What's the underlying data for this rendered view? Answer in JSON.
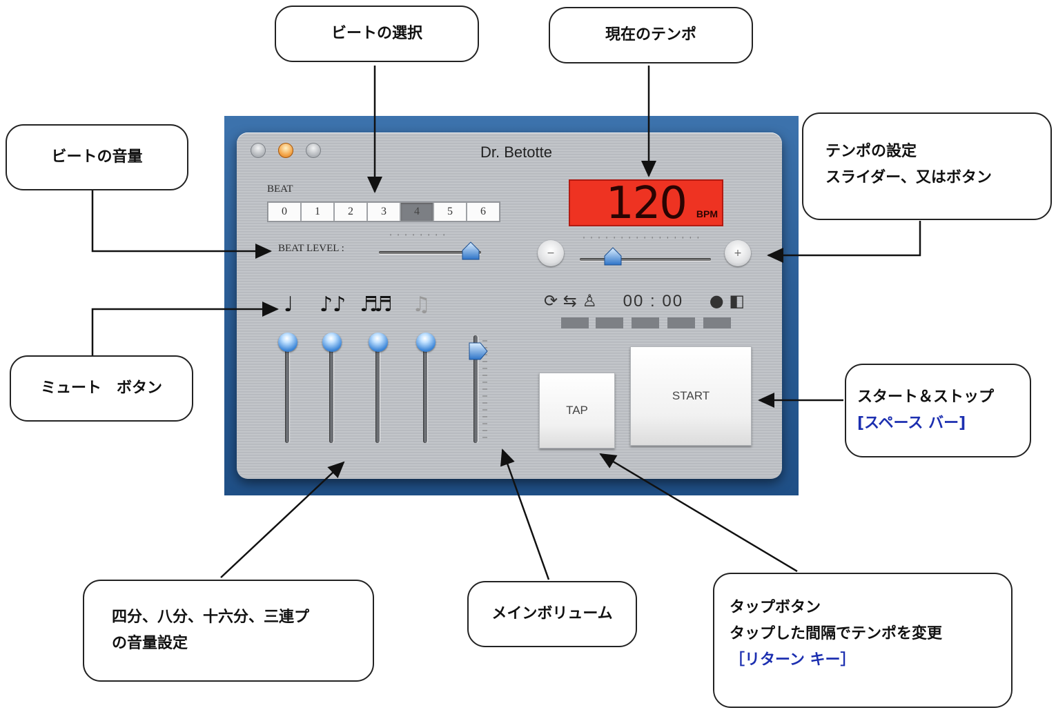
{
  "window": {
    "title": "Dr. Betotte",
    "beat_label": "BEAT",
    "beats": [
      "0",
      "1",
      "2",
      "3",
      "4",
      "5",
      "6"
    ],
    "selected_beat": "4",
    "beat_level_label": "BEAT LEVEL :",
    "beat_level": 0.9,
    "tempo_value": "120",
    "tempo_unit": "BPM",
    "tempo_slider": 0.25,
    "minus_label": "−",
    "plus_label": "+",
    "elapsed_time": "00 : 00",
    "tap_label": "TAP",
    "start_label": "START",
    "main_volume": 0.85,
    "lcd_color": "#ee3322"
  },
  "callouts": {
    "beat_select": "ビートの選択",
    "current_tempo": "現在のテンポ",
    "beat_volume": "ビートの音量",
    "tempo_setting_line1": "テンポの設定",
    "tempo_setting_line2": "スライダー、又はボタン",
    "mute_button": "ミュート　ボタン",
    "start_stop": "スタート＆ストップ",
    "start_stop_key": "[スペース バー]",
    "subdivision_line1": "四分、八分、十六分、三連プ",
    "subdivision_line2": "の音量設定",
    "main_volume": "メインボリューム",
    "tap_line1": "タップボタン",
    "tap_line2": "タップした間隔でテンポを変更",
    "tap_key": "［リターン キー］"
  }
}
